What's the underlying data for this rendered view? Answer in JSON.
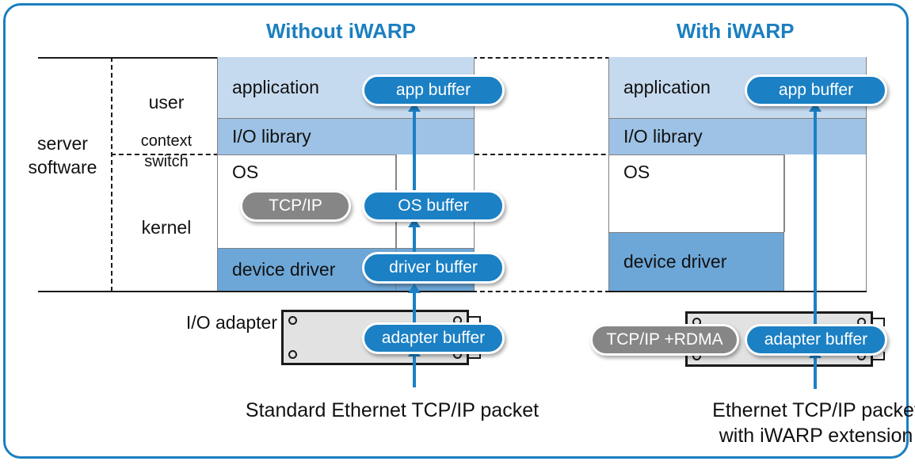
{
  "diagram": {
    "titles": {
      "left_column": "Without iWARP",
      "right_column": "With iWARP"
    },
    "side_labels": {
      "server_software": "server\nsoftware",
      "user": "user",
      "context_switch": "context\nswitch",
      "kernel": "kernel",
      "io_adapter": "I/O adapter"
    },
    "layers_without": {
      "application": "application",
      "io_library": "I/O library",
      "os": "OS",
      "device_driver": "device driver"
    },
    "layers_with": {
      "application": "application",
      "io_library": "I/O library",
      "os": "OS",
      "device_driver": "device driver"
    },
    "buffers_without": {
      "app_buffer": "app buffer",
      "os_buffer": "OS buffer",
      "driver_buffer": "driver buffer",
      "adapter_buffer": "adapter buffer",
      "tcp_ip": "TCP/IP"
    },
    "buffers_with": {
      "app_buffer": "app buffer",
      "adapter_buffer": "adapter buffer",
      "tcp_ip_rdma": "TCP/IP +RDMA"
    },
    "captions": {
      "left": "Standard Ethernet TCP/IP packet",
      "right": "Ethernet TCP/IP packet\nwith iWARP extension"
    },
    "colors": {
      "accent_blue": "#1b7fc0",
      "pill_blue": "#1b80c4",
      "pill_grey": "#868686",
      "application_layer": "#c6daef",
      "io_library_layer": "#9dc2e5",
      "device_driver_layer": "#6da7d8",
      "board_grey": "#e2e2e2",
      "line_black": "#1a1a1a"
    }
  }
}
